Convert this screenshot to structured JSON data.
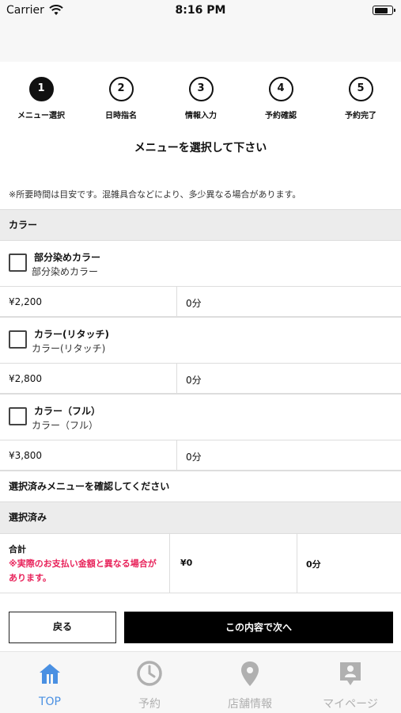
{
  "status_bar": {
    "carrier": "Carrier",
    "time": "8:16 PM",
    "battery_level": 0.8
  },
  "steps": [
    {
      "number": "1",
      "label": "メニュー選択",
      "active": true
    },
    {
      "number": "2",
      "label": "日時指名",
      "active": false
    },
    {
      "number": "3",
      "label": "情報入力",
      "active": false
    },
    {
      "number": "4",
      "label": "予約確認",
      "active": false
    },
    {
      "number": "5",
      "label": "予約完了",
      "active": false
    }
  ],
  "title": "メニューを選択して下さい",
  "note": "※所要時間は目安です。混雑具合などにより、多少異なる場合があります。",
  "category": "カラー",
  "menu_items": [
    {
      "title": "部分染めカラー",
      "subtitle": "部分染めカラー",
      "price": "¥2,200",
      "duration": "0分",
      "checked": false
    },
    {
      "title": "カラー(リタッチ)",
      "subtitle": "カラー(リタッチ)",
      "price": "¥2,800",
      "duration": "0分",
      "checked": false
    },
    {
      "title": "カラー（フル）",
      "subtitle": "カラー（フル）",
      "price": "¥3,800",
      "duration": "0分",
      "checked": false
    }
  ],
  "confirm_label": "選択済みメニューを確認してください",
  "selected_header": "選択済み",
  "total": {
    "label": "合計",
    "warning": "※実際のお支払い金額と異なる場合があります。",
    "price": "¥0",
    "duration": "0分"
  },
  "buttons": {
    "back": "戻る",
    "next": "この内容で次へ"
  },
  "tab_bar": [
    {
      "label": "TOP",
      "icon": "home-icon",
      "active": true
    },
    {
      "label": "予約",
      "icon": "clock-icon",
      "active": false
    },
    {
      "label": "店舗情報",
      "icon": "location-pin-icon",
      "active": false
    },
    {
      "label": "マイページ",
      "icon": "profile-icon",
      "active": false
    }
  ],
  "colors": {
    "accent": "#4a90e2",
    "warning": "#e8225a",
    "inactive_tab": "#b0b0b0",
    "primary_button": "#000000"
  }
}
